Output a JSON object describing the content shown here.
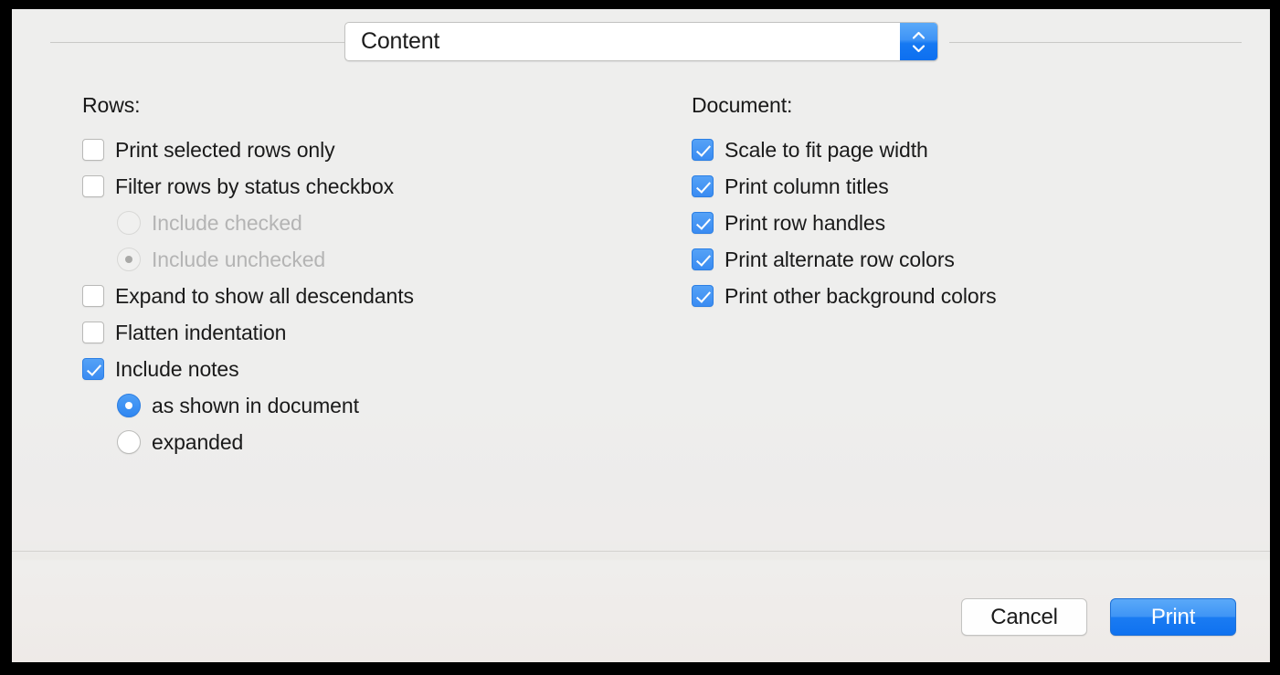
{
  "dialog": {
    "popup": {
      "selected": "Content",
      "stepper_icon": "chevron-up-down-icon"
    }
  },
  "rows_section": {
    "title": "Rows:",
    "options": [
      {
        "label": "Print selected rows only",
        "type": "checkbox",
        "checked": false,
        "enabled": true,
        "indent": false
      },
      {
        "label": "Filter rows by status checkbox",
        "type": "checkbox",
        "checked": false,
        "enabled": true,
        "indent": false
      },
      {
        "label": "Include checked",
        "type": "radio",
        "checked": false,
        "enabled": false,
        "indent": true
      },
      {
        "label": "Include unchecked",
        "type": "radio",
        "checked": true,
        "enabled": false,
        "indent": true
      },
      {
        "label": "Expand to show all descendants",
        "type": "checkbox",
        "checked": false,
        "enabled": true,
        "indent": false
      },
      {
        "label": "Flatten indentation",
        "type": "checkbox",
        "checked": false,
        "enabled": true,
        "indent": false
      },
      {
        "label": "Include notes",
        "type": "checkbox",
        "checked": true,
        "enabled": true,
        "indent": false
      },
      {
        "label": "as shown in document",
        "type": "radio",
        "checked": true,
        "enabled": true,
        "indent": true
      },
      {
        "label": "expanded",
        "type": "radio",
        "checked": false,
        "enabled": true,
        "indent": true
      }
    ]
  },
  "document_section": {
    "title": "Document:",
    "options": [
      {
        "label": "Scale to fit page width",
        "type": "checkbox",
        "checked": true,
        "enabled": true,
        "indent": false
      },
      {
        "label": "Print column titles",
        "type": "checkbox",
        "checked": true,
        "enabled": true,
        "indent": false
      },
      {
        "label": "Print row handles",
        "type": "checkbox",
        "checked": true,
        "enabled": true,
        "indent": false
      },
      {
        "label": "Print alternate row colors",
        "type": "checkbox",
        "checked": true,
        "enabled": true,
        "indent": false
      },
      {
        "label": "Print other background colors",
        "type": "checkbox",
        "checked": true,
        "enabled": true,
        "indent": false
      }
    ]
  },
  "footer": {
    "cancel_label": "Cancel",
    "print_label": "Print"
  },
  "colors": {
    "accent_blue": "#3a8cf2",
    "sheet_background": "#eeeeed",
    "text": "#1a1a1a",
    "disabled_text": "#b4b4b4",
    "divider": "#c9c9c7",
    "frame": "#000000"
  }
}
